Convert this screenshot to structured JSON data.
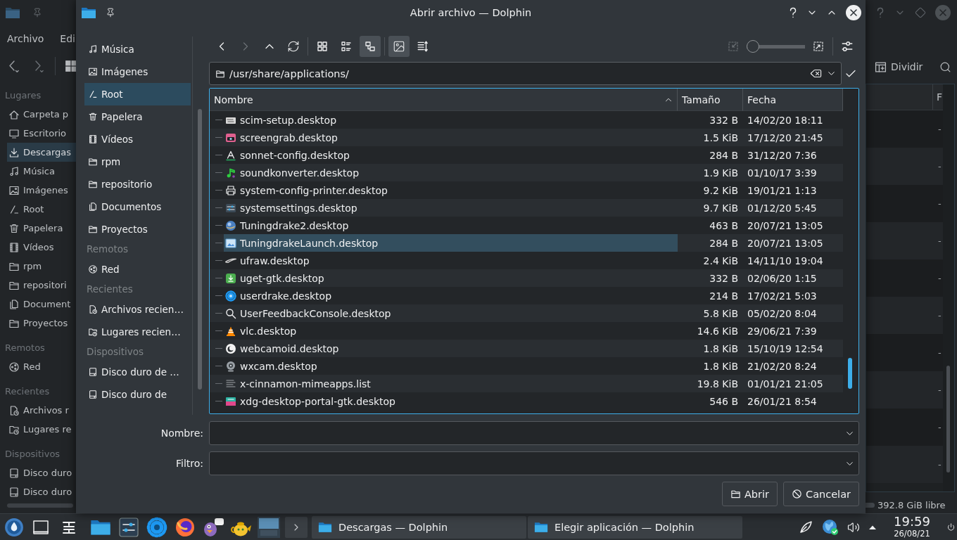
{
  "background_window": {
    "menu": [
      "Archivo",
      "Edi"
    ],
    "sidebar": [
      {
        "header": "Lugares",
        "items": [
          {
            "label": "Carpeta p",
            "selected": false
          },
          {
            "label": "Escritorio",
            "selected": false
          },
          {
            "label": "Descargas",
            "selected": true
          },
          {
            "label": "Música",
            "selected": false
          },
          {
            "label": "Imágenes",
            "selected": false
          },
          {
            "label": "Root",
            "selected": false
          },
          {
            "label": "Papelera",
            "selected": false
          },
          {
            "label": "Vídeos",
            "selected": false
          },
          {
            "label": "rpm",
            "selected": false
          },
          {
            "label": "repositori",
            "selected": false
          },
          {
            "label": "Document",
            "selected": false
          },
          {
            "label": "Proyectos",
            "selected": false
          }
        ]
      },
      {
        "header": "Remotos",
        "items": [
          {
            "label": "Red",
            "selected": false
          }
        ]
      },
      {
        "header": "Recientes",
        "items": [
          {
            "label": "Archivos r",
            "selected": false
          },
          {
            "label": "Lugares re",
            "selected": false
          }
        ]
      },
      {
        "header": "Dispositivos",
        "items": [
          {
            "label": "Disco duro",
            "selected": false
          },
          {
            "label": "Disco duro",
            "selected": false
          }
        ]
      }
    ],
    "split_button": "Dividir",
    "list": {
      "column_1": "F",
      "rows": [
        {
          "column_1": "-"
        },
        {
          "column_1": "-"
        },
        {
          "column_1": "-"
        },
        {
          "column_1": "-"
        },
        {
          "column_1": "-"
        },
        {
          "column_1": "-"
        },
        {
          "column_1": "-"
        },
        {
          "column_1": "-"
        },
        {
          "column_1": "-"
        },
        {
          "column_1": "-"
        }
      ]
    },
    "status_bar": {
      "free_space": "392.8 GiB libre"
    }
  },
  "dialog": {
    "title": "Abrir archivo — Dolphin",
    "sidebar": [
      {
        "items": [
          {
            "label": "Música",
            "selected": false
          },
          {
            "label": "Imágenes",
            "selected": false
          },
          {
            "label": "Root",
            "selected": true
          },
          {
            "label": "Papelera",
            "selected": false
          },
          {
            "label": "Vídeos",
            "selected": false
          },
          {
            "label": "rpm",
            "selected": false
          },
          {
            "label": "repositorio",
            "selected": false
          },
          {
            "label": "Documentos",
            "selected": false
          },
          {
            "label": "Proyectos",
            "selected": false
          }
        ]
      },
      {
        "header": "Remotos",
        "items": [
          {
            "label": "Red",
            "selected": false
          }
        ]
      },
      {
        "header": "Recientes",
        "items": [
          {
            "label": "Archivos recien…",
            "selected": false
          },
          {
            "label": "Lugares recien…",
            "selected": false
          }
        ]
      },
      {
        "header": "Dispositivos",
        "items": [
          {
            "label": "Disco duro de …",
            "selected": false
          },
          {
            "label": "Disco duro de",
            "selected": false
          }
        ]
      }
    ],
    "toolbar": {
      "navigation": [
        {
          "disabled": false
        },
        {
          "disabled": true
        },
        {
          "disabled": false
        },
        {
          "disabled": false
        }
      ],
      "view_modes": [
        {
          "selected": false
        },
        {
          "selected": false
        },
        {
          "selected": true
        }
      ],
      "preview": {
        "on": true
      },
      "zoom": {
        "level": 0,
        "buttons": [
          {
            "disabled": true
          },
          {
            "disabled": false
          }
        ]
      }
    },
    "location": {
      "value": "/usr/share/applications/"
    },
    "file_list": {
      "columns": [
        {
          "label": "Nombre",
          "sorted": true
        },
        {
          "label": "Tamaño",
          "sorted": false
        },
        {
          "label": "Fecha",
          "sorted": false
        }
      ],
      "rows": [
        {
          "name": "scim-setup.desktop",
          "size": "332 B",
          "date": "14/02/20 18:11",
          "selected": false
        },
        {
          "name": "screengrab.desktop",
          "size": "1.5 KiB",
          "date": "17/12/20 21:45",
          "selected": false
        },
        {
          "name": "sonnet-config.desktop",
          "size": "284 B",
          "date": "31/12/20 7:36",
          "selected": false
        },
        {
          "name": "soundkonverter.desktop",
          "size": "1.9 KiB",
          "date": "01/10/17 3:39",
          "selected": false
        },
        {
          "name": "system-config-printer.desktop",
          "size": "9.2 KiB",
          "date": "19/01/21 1:13",
          "selected": false
        },
        {
          "name": "systemsettings.desktop",
          "size": "9.7 KiB",
          "date": "01/12/20 5:45",
          "selected": false
        },
        {
          "name": "Tuningdrake2.desktop",
          "size": "463 B",
          "date": "20/07/21 13:05",
          "selected": false
        },
        {
          "name": "TuningdrakeLaunch.desktop",
          "size": "284 B",
          "date": "20/07/21 13:05",
          "selected": true
        },
        {
          "name": "ufraw.desktop",
          "size": "2.4 KiB",
          "date": "14/11/10 19:04",
          "selected": false
        },
        {
          "name": "uget-gtk.desktop",
          "size": "332 B",
          "date": "02/06/20 1:15",
          "selected": false
        },
        {
          "name": "userdrake.desktop",
          "size": "214 B",
          "date": "17/02/21 5:03",
          "selected": false
        },
        {
          "name": "UserFeedbackConsole.desktop",
          "size": "5.8 KiB",
          "date": "05/02/20 8:04",
          "selected": false
        },
        {
          "name": "vlc.desktop",
          "size": "14.6 KiB",
          "date": "29/06/21 7:39",
          "selected": false
        },
        {
          "name": "webcamoid.desktop",
          "size": "1.8 KiB",
          "date": "15/10/19 12:54",
          "selected": false
        },
        {
          "name": "wxcam.desktop",
          "size": "1.8 KiB",
          "date": "21/02/20 8:24",
          "selected": false
        },
        {
          "name": "x-cinnamon-mimeapps.list",
          "size": "19.8 KiB",
          "date": "01/01/21 21:05",
          "selected": false
        },
        {
          "name": "xdg-desktop-portal-gtk.desktop",
          "size": "546 B",
          "date": "26/01/21 8:54",
          "selected": false
        }
      ]
    },
    "form": {
      "fields": [
        {
          "label": "Nombre:"
        },
        {
          "label": "Filtro:"
        }
      ]
    },
    "buttons": [
      "Abrir",
      "Cancelar"
    ]
  },
  "taskbar": {
    "tasks": [
      {
        "label": "Descargas — Dolphin"
      },
      {
        "label": "Elegir aplicación — Dolphin"
      }
    ],
    "clock": {
      "time": "19:59",
      "date": "26/08/21"
    }
  }
}
